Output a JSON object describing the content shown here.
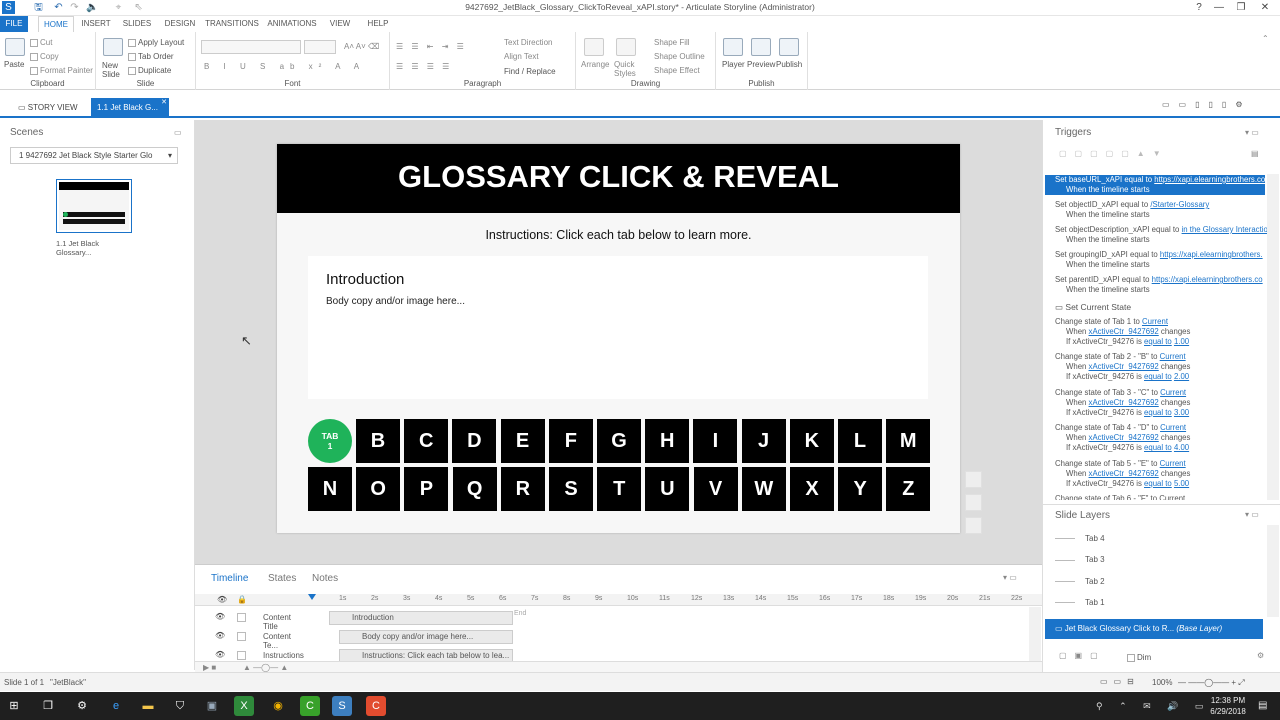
{
  "window": {
    "title": "9427692_JetBlack_Glossary_ClickToReveal_xAPI.story* - Articulate Storyline (Administrator)",
    "min": "—",
    "restore": "❐",
    "close": "✕"
  },
  "ribbon_tabs": [
    "FILE",
    "HOME",
    "INSERT",
    "SLIDES",
    "DESIGN",
    "TRANSITIONS",
    "ANIMATIONS",
    "VIEW",
    "HELP"
  ],
  "ribbon": {
    "clipboard": {
      "label": "Clipboard",
      "paste": "Paste",
      "cut": "Cut",
      "copy": "Copy",
      "format_painter": "Format Painter"
    },
    "slide": {
      "label": "Slide",
      "new_slide": "New Slide",
      "apply_layout": "Apply Layout",
      "tab_order": "Tab Order",
      "duplicate": "Duplicate"
    },
    "font": {
      "label": "Font"
    },
    "paragraph": {
      "label": "Paragraph",
      "text_direction": "Text Direction",
      "align_text": "Align Text",
      "find_replace": "Find / Replace"
    },
    "drawing": {
      "label": "Drawing",
      "arrange": "Arrange",
      "quick_styles": "Quick Styles",
      "shape_fill": "Shape Fill",
      "shape_outline": "Shape Outline",
      "shape_effect": "Shape Effect"
    },
    "publish": {
      "label": "Publish",
      "player": "Player",
      "preview": "Preview",
      "publish": "Publish"
    }
  },
  "views": {
    "story_view": "STORY VIEW",
    "slide_tab": "1.1 Jet Black G..."
  },
  "scenes": {
    "title": "Scenes",
    "dropdown": "1 9427692 Jet Black Style Starter Glo",
    "thumb_label": "1.1 Jet Black Glossary..."
  },
  "slide": {
    "header": "GLOSSARY CLICK & REVEAL",
    "instructions": "Instructions: Click each tab below to learn more.",
    "panel_title": "Introduction",
    "panel_body": "Body copy and/or image here...",
    "tab_circle": "TAB\n1",
    "row1": [
      "B",
      "C",
      "D",
      "E",
      "F",
      "G",
      "H",
      "I",
      "J",
      "K",
      "L",
      "M"
    ],
    "row2": [
      "N",
      "O",
      "P",
      "Q",
      "R",
      "S",
      "T",
      "U",
      "V",
      "W",
      "X",
      "Y",
      "Z"
    ]
  },
  "bottom": {
    "tabs": [
      "Timeline",
      "States",
      "Notes"
    ],
    "ticks": [
      "1s",
      "2s",
      "3s",
      "4s",
      "5s",
      "6s",
      "7s",
      "8s",
      "9s",
      "10s",
      "11s",
      "12s",
      "13s",
      "14s",
      "15s",
      "16s",
      "17s",
      "18s",
      "19s",
      "20s",
      "21s",
      "22s"
    ],
    "end": "End",
    "rows": [
      {
        "name": "Content Title",
        "bar": "Introduction"
      },
      {
        "name": "Content Te...",
        "bar": "Body copy and/or image here..."
      },
      {
        "name": "Instructions",
        "bar": "Instructions: Click each tab below to lea..."
      }
    ]
  },
  "triggers": {
    "title": "Triggers",
    "items": [
      {
        "a": "Set baseURL_xAPI equal to ",
        "link": "https://xapi.elearningbrothers.co",
        "b": "When the timeline starts"
      },
      {
        "a": "Set objectID_xAPI equal to ",
        "link": "/Starter-Glossary",
        "b": "When the timeline starts"
      },
      {
        "a": "Set objectDescription_xAPI equal to ",
        "link": "in the Glossary Interactio",
        "b": "When the timeline starts"
      },
      {
        "a": "Set groupingID_xAPI equal to ",
        "link": "https://xapi.elearningbrothers.",
        "b": "When the timeline starts"
      },
      {
        "a": "Set parentID_xAPI equal to ",
        "link": "https://xapi.elearningbrothers.co",
        "b": "When the timeline starts"
      }
    ],
    "group": "Set Current State",
    "states": [
      {
        "a": "Change state of Tab 1 to ",
        "s": "Current",
        "w": "xActiveCtr_9427692",
        "v": "1.00"
      },
      {
        "a": "Change state of Tab 2 - \"B\" to ",
        "s": "Current",
        "w": "xActiveCtr_9427692",
        "v": "2.00"
      },
      {
        "a": "Change state of Tab 3 - \"C\" to ",
        "s": "Current",
        "w": "xActiveCtr_9427692",
        "v": "3.00"
      },
      {
        "a": "Change state of Tab 4 - \"D\" to ",
        "s": "Current",
        "w": "xActiveCtr_9427692",
        "v": "4.00"
      },
      {
        "a": "Change state of Tab 5 - \"E\" to ",
        "s": "Current",
        "w": "xActiveCtr_9427692",
        "v": "5.00"
      }
    ],
    "when": "When ",
    "changes": " changes",
    "if": "If xActiveCtr_94276  is ",
    "equal": "equal to",
    "cut": "Change state of Tab 6 - \"F\" to Current"
  },
  "layers": {
    "title": "Slide Layers",
    "items": [
      "Tab 4",
      "Tab 3",
      "Tab 2",
      "Tab 1"
    ],
    "base": "Jet Black Glossary Click to R...",
    "base_tag": "(Base Layer)",
    "dim": "Dim"
  },
  "status": {
    "slide": "Slide 1 of 1",
    "theme": "\"JetBlack\"",
    "zoom": "100%"
  },
  "taskbar": {
    "time": "12:38 PM",
    "date": "6/29/2018"
  }
}
